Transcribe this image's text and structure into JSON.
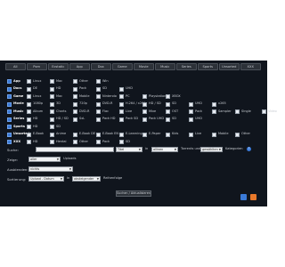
{
  "tabs": [
    "All",
    "Porn",
    "Ecstatic",
    "App",
    "Dox",
    "Game",
    "Movie",
    "Music",
    "Series",
    "Sports",
    "Unsorted",
    "XXX"
  ],
  "categories": [
    {
      "head": "App",
      "items": [
        "Linux",
        "Mac",
        "Other",
        "Win"
      ]
    },
    {
      "head": "Docs",
      "items": [
        "DE",
        "HD",
        "Pack",
        "SD",
        "UHD"
      ]
    },
    {
      "head": "Game",
      "items": [
        "Linux",
        "Mac",
        "Mobile",
        "Nintendo",
        "PC",
        "Playstation",
        "XBOX"
      ]
    },
    {
      "head": "Movie",
      "items": [
        "1080p",
        "3D",
        "720p",
        "DVD-R",
        "H.264 / x264",
        "HD / SD",
        "SD",
        "UHD",
        "x265"
      ]
    },
    {
      "head": "Music",
      "items": [
        "Album",
        "Charts",
        "DVD-R",
        "Flac",
        "Live",
        "Mixe",
        "OST",
        "Pack",
        "Sampler",
        "Single",
        "Video"
      ]
    },
    {
      "head": "Series",
      "items": [
        "HD",
        "HD / SD",
        "SxL",
        "Pack HD",
        "Pack SD",
        "Pack UHD",
        "SD",
        "UHD"
      ]
    },
    {
      "head": "Sports",
      "items": [
        "HD",
        "SD"
      ]
    },
    {
      "head": "Unsorted",
      "items": [
        "E-Book",
        "Anime",
        "E-Book DE",
        "E-Book EN",
        "E-Learning",
        "E-Paper",
        "Kids",
        "Live",
        "Mobile",
        "Other"
      ]
    },
    {
      "head": "XXX",
      "items": [
        "HD",
        "Hentai",
        "Other",
        "Pack",
        "SD"
      ]
    }
  ],
  "search": {
    "label": "Suche:",
    "field_sel": "Titel",
    "in_label": "in",
    "mode_sel": "allinen",
    "torrents_label": "Torrents und",
    "filter_sel": "gewählten",
    "categories_label": "Kategorien",
    "help": "?"
  },
  "show": {
    "label": "Zeige:",
    "value": "aller",
    "suffix": "Uploads"
  },
  "exclusion": {
    "label": "Ausblenden:",
    "value": "nichts"
  },
  "sorting": {
    "label": "Sortierung:",
    "value": "Upload - Datum",
    "in_label": "in",
    "order_value": "absteigender",
    "suffix": "Reihenfolge"
  },
  "submit": "Suchen / Aktualisieren",
  "icons": {
    "feed1": "rss-feed-icon",
    "feed2": "rss-icon"
  },
  "colors": {
    "panel": "#10151d",
    "accent": "#3a7ad8",
    "rss": "#e8782a"
  }
}
